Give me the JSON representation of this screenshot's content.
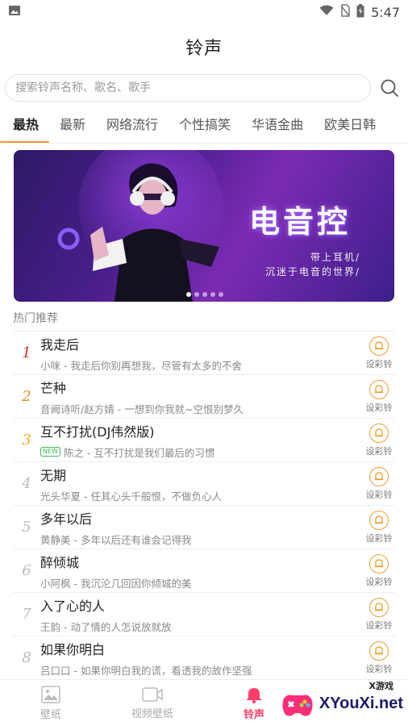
{
  "status": {
    "time": "5:47"
  },
  "app": {
    "title": "铃声"
  },
  "search": {
    "placeholder": "搜索铃声名称、歌名、歌手"
  },
  "tabs": [
    "最热",
    "最新",
    "网络流行",
    "个性搞笑",
    "华语金曲",
    "欧美日韩"
  ],
  "banner": {
    "title": "电音控",
    "line1": "带上耳机/",
    "line2": "沉迷于电音的世界/",
    "dot_count": 5,
    "active_dot": 0
  },
  "section": {
    "title": "热门推荐"
  },
  "set_label": "设彩铃",
  "songs": [
    {
      "rank": "1",
      "title": "我走后",
      "subtitle": "小咪 - 我走后你别再想我，尽管有太多的不舍",
      "new": false
    },
    {
      "rank": "2",
      "title": "芒种",
      "subtitle": "音阙诗听/赵方婧 - 一想到你我就~空恨别梦久",
      "new": false
    },
    {
      "rank": "3",
      "title": "互不打扰(DJ伟然版)",
      "subtitle": "陈之 - 互不打扰是我们最后的习惯",
      "new": true,
      "new_label": "NEW"
    },
    {
      "rank": "4",
      "title": "无期",
      "subtitle": "光头华夏 - 任其心头千般恨，不做负心人",
      "new": false
    },
    {
      "rank": "5",
      "title": "多年以后",
      "subtitle": "黄静美 - 多年以后还有谁会记得我",
      "new": false
    },
    {
      "rank": "6",
      "title": "醉倾城",
      "subtitle": "小阿枫 - 我沉沦几回因你倾城的美",
      "new": false
    },
    {
      "rank": "7",
      "title": "入了心的人",
      "subtitle": "王韵 - 动了情的人怎说放就放",
      "new": false
    },
    {
      "rank": "8",
      "title": "如果你明白",
      "subtitle": "吕口口 - 如果你明白我的谎，看透我的故作坚强",
      "new": false
    }
  ],
  "nav": [
    {
      "label": "壁纸",
      "icon": "image-icon",
      "active": false
    },
    {
      "label": "视频壁纸",
      "icon": "video-icon",
      "active": false
    },
    {
      "label": "铃声",
      "icon": "bell-icon",
      "active": true
    }
  ],
  "watermark": {
    "text": "XYouXi.net",
    "small": "X游戏"
  },
  "colors": {
    "accent": "#f39a2c",
    "nav_active": "#ff3e6c",
    "rank1": "#e02a2a",
    "rank2": "#f08a1d",
    "rank3": "#f0b020"
  }
}
